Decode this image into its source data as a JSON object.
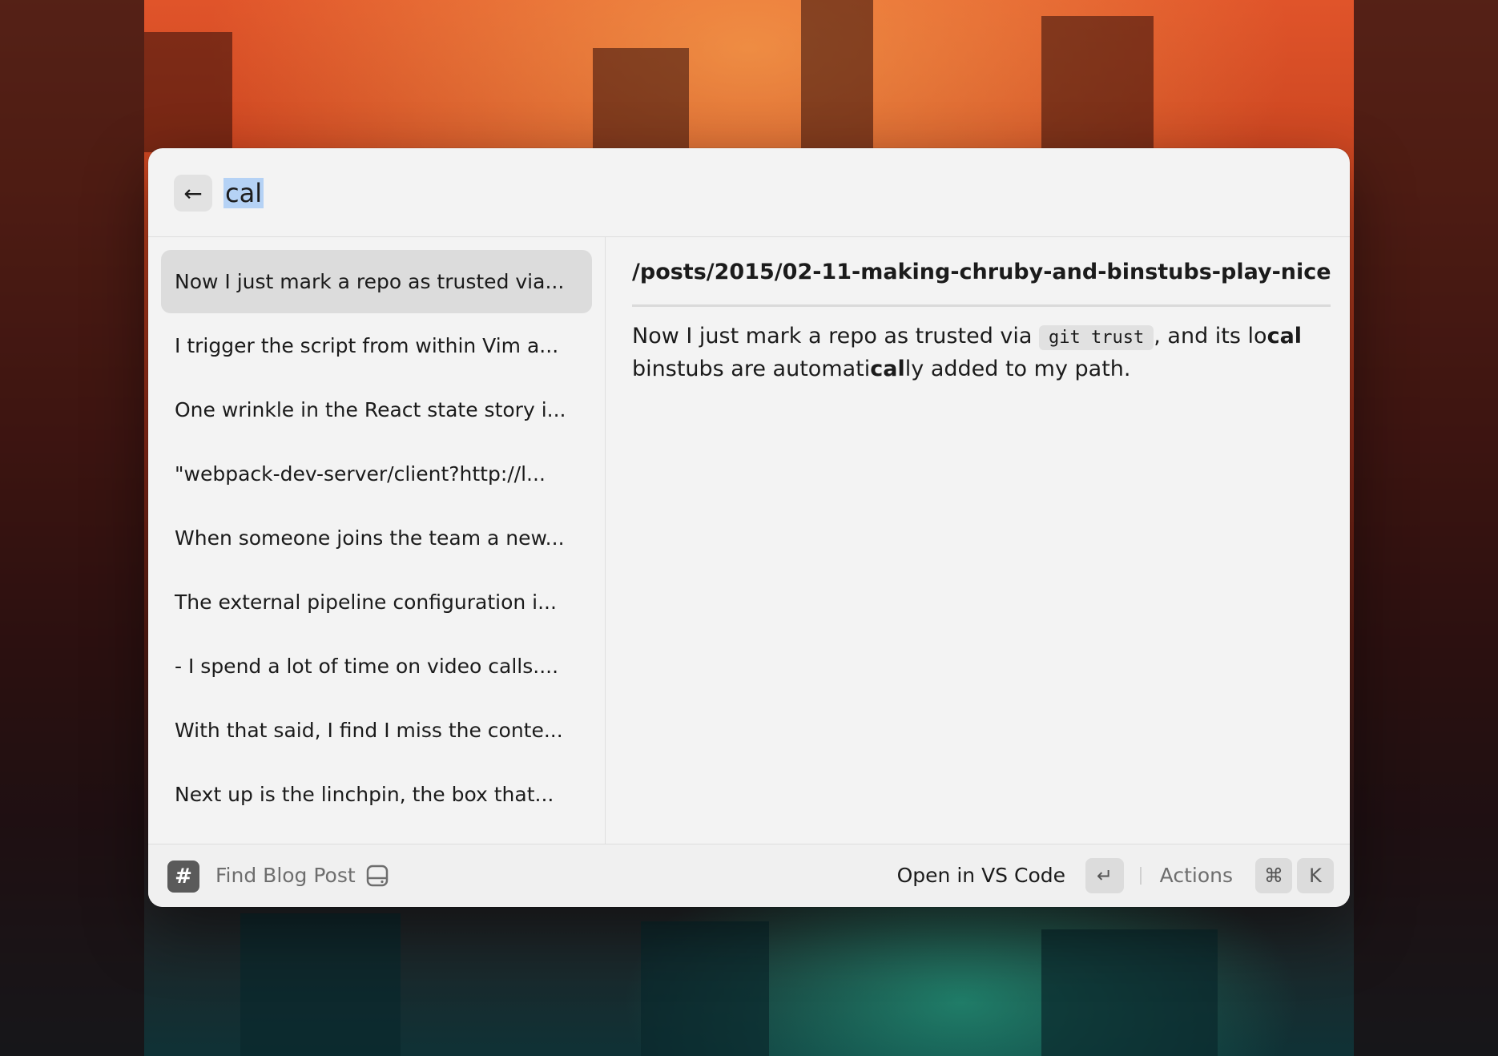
{
  "search": {
    "query": "cal",
    "back_icon": "arrow-left-icon"
  },
  "list": {
    "items": [
      "Now I just mark a repo as trusted via...",
      "I trigger the script from within Vim a...",
      "One wrinkle in the React state story i...",
      "\"webpack-dev-server/client?http://l...",
      "When someone joins the team a new...",
      "The external pipeline configuration i...",
      "- I spend a lot of time on video calls....",
      "With that said, I find I miss the conte...",
      "Next up is the linchpin, the box that..."
    ],
    "selected_index": 0
  },
  "detail": {
    "title": "/posts/2015/02-11-making-chruby-and-binstubs-play-nice",
    "body_part1": "Now I just mark a repo as trusted via ",
    "body_code": "git trust",
    "body_part2": ", and its lo",
    "body_match1": "cal",
    "body_part3": " binstubs are automati",
    "body_match2": "cal",
    "body_part4": "ly added to my path."
  },
  "footer": {
    "extension_icon": "#",
    "extension_name": "Find Blog Post",
    "drive_icon": "hard-drive-icon",
    "primary_action": "Open in VS Code",
    "primary_shortcut": "↵",
    "actions_label": "Actions",
    "actions_shortcut_mod": "⌘",
    "actions_shortcut_key": "K"
  }
}
